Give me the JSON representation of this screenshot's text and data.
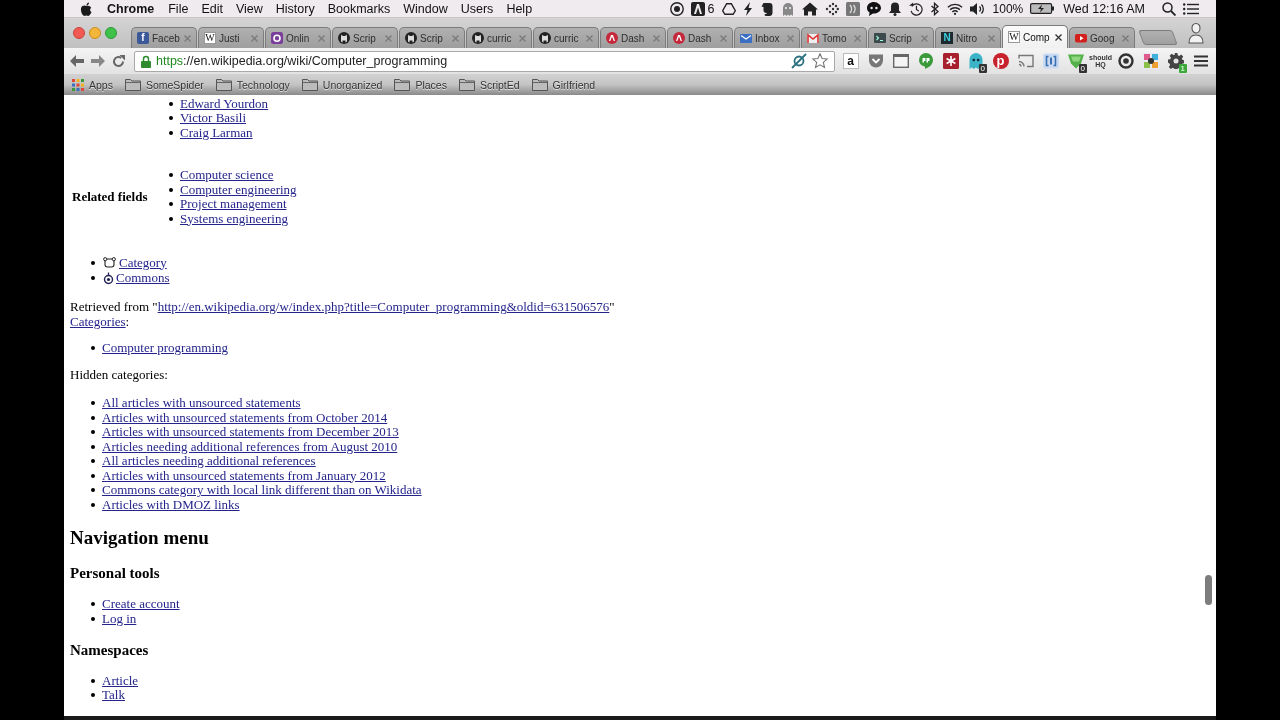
{
  "menu_bar": {
    "app": "Chrome",
    "menus": [
      "File",
      "Edit",
      "View",
      "History",
      "Bookmarks",
      "Window",
      "Users",
      "Help"
    ],
    "count": "6",
    "battery": "100%",
    "clock": "Wed 12:16 AM"
  },
  "tabs": [
    {
      "title": "Faceb",
      "kind": "letterblue",
      "icon_text": "f",
      "selected": false
    },
    {
      "title": "Justi",
      "kind": "letter",
      "icon_text": "W",
      "selected": false
    },
    {
      "title": "Onlin",
      "kind": "ring",
      "selected": false
    },
    {
      "title": "Scrip",
      "kind": "github",
      "selected": false
    },
    {
      "title": "Scrip",
      "kind": "github",
      "selected": false
    },
    {
      "title": "curric",
      "kind": "github",
      "selected": false
    },
    {
      "title": "curric",
      "kind": "github",
      "selected": false
    },
    {
      "title": "Dash",
      "kind": "dash",
      "selected": false
    },
    {
      "title": "Dash",
      "kind": "dash",
      "selected": false
    },
    {
      "title": "Inbox",
      "kind": "envelope",
      "selected": false
    },
    {
      "title": "Tomo",
      "kind": "mail",
      "selected": false
    },
    {
      "title": "Scrip",
      "kind": "terminal",
      "selected": false
    },
    {
      "title": "Nitro",
      "kind": "letterdark",
      "icon_text": "N",
      "selected": false
    },
    {
      "title": "Comp",
      "kind": "letter",
      "icon_text": "W",
      "selected": true
    },
    {
      "title": "Goog",
      "kind": "play",
      "selected": false
    }
  ],
  "toolbar": {
    "url_scheme": "https",
    "url_rest": "://en.wikipedia.org/wiki/Computer_programming",
    "extensions": [
      {
        "kind": "letter",
        "icon_text": "a"
      },
      {
        "kind": "pocket"
      },
      {
        "kind": "window"
      },
      {
        "kind": "bubble"
      },
      {
        "kind": "asterisk"
      },
      {
        "kind": "ghost",
        "badge": "0"
      },
      {
        "kind": "roundletter",
        "icon_text": "p"
      },
      {
        "kind": "cast"
      },
      {
        "kind": "brackets"
      },
      {
        "kind": "shield",
        "badge": "0"
      },
      {
        "kind": "text",
        "icon_text": "should HQ"
      },
      {
        "kind": "ring"
      },
      {
        "kind": "picture"
      },
      {
        "kind": "gear",
        "badge": "1"
      }
    ]
  },
  "bookmarks": [
    {
      "kind": "apps",
      "label": "Apps"
    },
    {
      "kind": "folder",
      "label": "SomeSpider"
    },
    {
      "kind": "folder",
      "label": "Technology"
    },
    {
      "kind": "folder",
      "label": "Unorganized"
    },
    {
      "kind": "folder",
      "label": "Places"
    },
    {
      "kind": "folder",
      "label": "ScriptEd"
    },
    {
      "kind": "folder",
      "label": "Girlfriend"
    }
  ],
  "page": {
    "navbox": [
      {
        "links": [
          "Edward Yourdon",
          "Victor Basili",
          "Craig Larman"
        ]
      },
      {
        "label": "Related fields",
        "links": [
          "Computer science",
          "Computer engineering",
          "Project management",
          "Systems engineering"
        ]
      }
    ],
    "sister_links": [
      {
        "kind": "category",
        "label": "Category"
      },
      {
        "kind": "commons",
        "label": "Commons"
      }
    ],
    "retrieved": {
      "prefix": "Retrieved from \"",
      "link": "http://en.wikipedia.org/w/index.php?title=Computer_programming&oldid=631506576",
      "suffix": "\""
    },
    "categories": {
      "link": "Categories",
      "suffix": ":",
      "links": [
        "Computer programming"
      ]
    },
    "hidden_categories": {
      "label": "Hidden categories:",
      "links": [
        "All articles with unsourced statements",
        "Articles with unsourced statements from October 2014",
        "Articles with unsourced statements from December 2013",
        "Articles needing additional references from August 2010",
        "All articles needing additional references",
        "Articles with unsourced statements from January 2012",
        "Commons category with local link different than on Wikidata",
        "Articles with DMOZ links"
      ]
    },
    "nav_heading": "Navigation menu",
    "sections": [
      {
        "heading": "Personal tools",
        "links": [
          "Create account",
          "Log in"
        ]
      },
      {
        "heading": "Namespaces",
        "links": [
          "Article",
          "Talk"
        ]
      }
    ]
  }
}
